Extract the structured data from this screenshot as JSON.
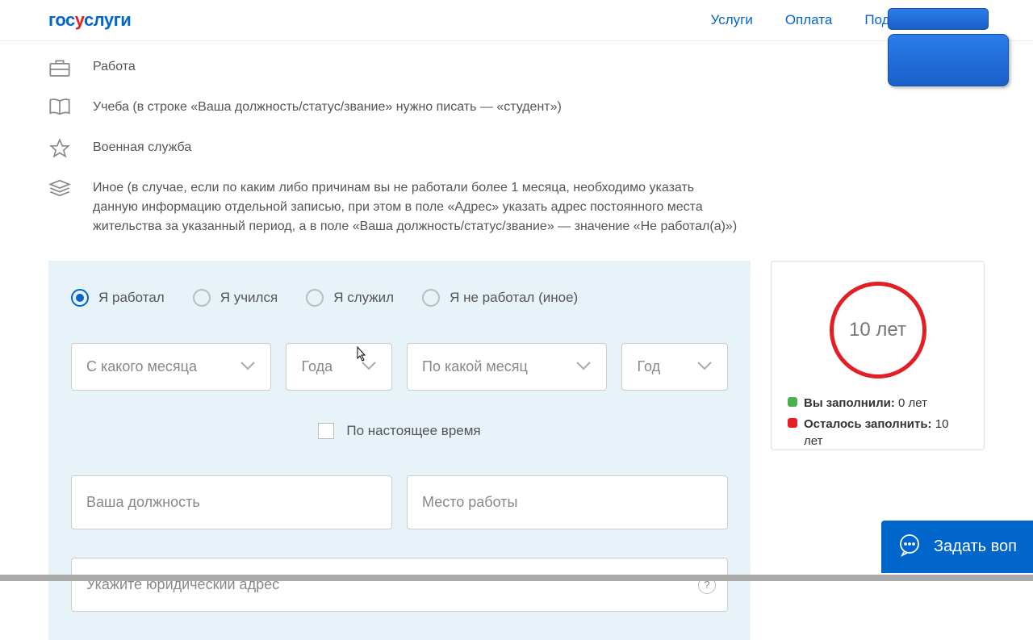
{
  "logo": {
    "part1": "гос",
    "part2": "у",
    "part3": "слуги"
  },
  "nav": {
    "services": "Услуги",
    "payment": "Оплата",
    "support": "Поддержка"
  },
  "info": {
    "work": "Работа",
    "study": "Учеба (в строке «Ваша должность/статус/звание» нужно писать — «студент»)",
    "military": "Военная служба",
    "other": "Иное (в случае, если по каким либо причинам вы не работали более 1 месяца, необходимо указать данную информацию отдельной записью, при этом в поле «Адрес» указать адрес постоянного места жительства за указанный период, а в поле «Ваша должность/статус/звание» — значение «Не работал(а)»)"
  },
  "radios": {
    "worked": "Я работал",
    "studied": "Я учился",
    "served": "Я служил",
    "none": "Я не работал (иное)"
  },
  "dropdowns": {
    "fromMonth": "С какого месяца",
    "fromYear": "Года",
    "toMonth": "По какой месяц",
    "toYear": "Год"
  },
  "checkbox": {
    "present": "По настоящее время"
  },
  "inputs": {
    "position": "Ваша должность",
    "workplace": "Место работы",
    "address": "Укажите юридический адрес"
  },
  "progress": {
    "circleText": "10 лет",
    "filledLabel": "Вы заполнили:",
    "filledValue": " 0 лет",
    "remainingLabel": "Осталось заполнить:",
    "remainingValue": " 10 лет"
  },
  "askButton": "Задать воп",
  "helpChar": "?"
}
